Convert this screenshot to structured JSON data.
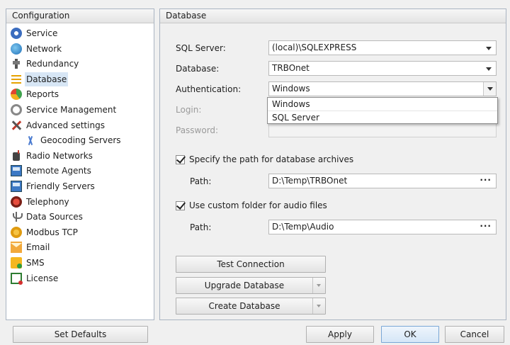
{
  "left_panel": {
    "title": "Configuration",
    "items": [
      {
        "label": "Service",
        "icon": "gear-icon"
      },
      {
        "label": "Network",
        "icon": "globe-icon"
      },
      {
        "label": "Redundancy",
        "icon": "plug-icon"
      },
      {
        "label": "Database",
        "icon": "database-icon",
        "selected": true
      },
      {
        "label": "Reports",
        "icon": "reports-icon"
      },
      {
        "label": "Service Management",
        "icon": "cog-icon"
      },
      {
        "label": "Advanced settings",
        "icon": "tools-icon"
      },
      {
        "label": "Geocoding Servers",
        "icon": "geocoding-icon",
        "indent": true
      },
      {
        "label": "Radio Networks",
        "icon": "radio-icon"
      },
      {
        "label": "Remote Agents",
        "icon": "remote-agent-icon"
      },
      {
        "label": "Friendly Servers",
        "icon": "friendly-server-icon"
      },
      {
        "label": "Telephony",
        "icon": "telephony-icon"
      },
      {
        "label": "Data Sources",
        "icon": "data-sources-icon"
      },
      {
        "label": "Modbus TCP",
        "icon": "modbus-icon"
      },
      {
        "label": "Email",
        "icon": "email-icon"
      },
      {
        "label": "SMS",
        "icon": "sms-icon"
      },
      {
        "label": "License",
        "icon": "license-icon"
      }
    ]
  },
  "right_panel": {
    "title": "Database",
    "sql_server_label": "SQL Server:",
    "sql_server_value": "(local)\\SQLEXPRESS",
    "database_label": "Database:",
    "database_value": "TRBOnet",
    "authentication_label": "Authentication:",
    "authentication_value": "Windows",
    "authentication_options": [
      "Windows",
      "SQL Server"
    ],
    "login_label": "Login:",
    "password_label": "Password:",
    "archive_checkbox_label": "Specify the path for database archives",
    "archive_checked": true,
    "archive_path_label": "Path:",
    "archive_path_value": "D:\\Temp\\TRBOnet",
    "audio_checkbox_label": "Use custom folder for audio files",
    "audio_checked": true,
    "audio_path_label": "Path:",
    "audio_path_value": "D:\\Temp\\Audio",
    "browse_label": "···",
    "test_connection": "Test Connection",
    "upgrade_database": "Upgrade Database",
    "create_database": "Create Database"
  },
  "footer": {
    "set_defaults": "Set Defaults",
    "apply": "Apply",
    "ok": "OK",
    "cancel": "Cancel"
  }
}
